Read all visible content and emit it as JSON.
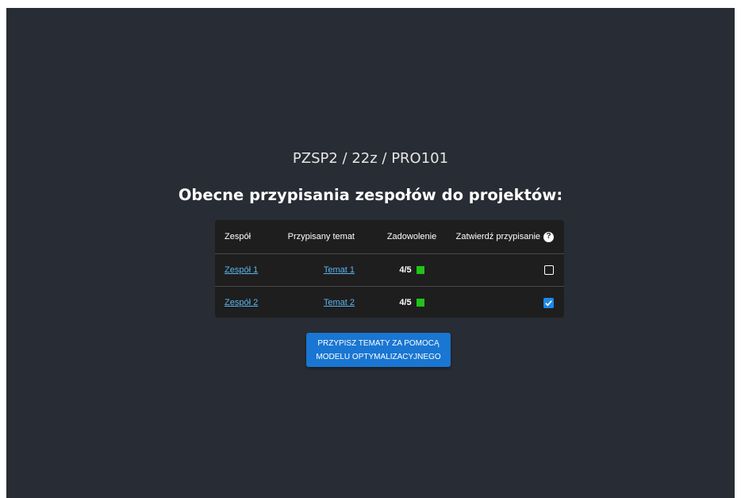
{
  "breadcrumb": "PZSP2 / 22z / PRO101",
  "page_title": "Obecne przypisania zespołów do projektów:",
  "table": {
    "headers": {
      "team": "Zespół",
      "topic": "Przypisany temat",
      "satisfaction": "Zadowolenie",
      "confirm": "Zatwierdź przypisanie",
      "help_icon": "?"
    },
    "rows": [
      {
        "team": "Zespół 1",
        "topic": "Temat 1",
        "satisfaction": "4/5",
        "satisfaction_color": "#22c318",
        "confirmed": false
      },
      {
        "team": "Zespół 2",
        "topic": "Temat 2",
        "satisfaction": "4/5",
        "satisfaction_color": "#22c318",
        "confirmed": true
      }
    ]
  },
  "assign_button": {
    "line1": "PRZYPISZ TEMATY ZA POMOCĄ",
    "line2": "MODELU OPTYMALIZACYJNEGO"
  },
  "colors": {
    "background": "#282c34",
    "table_background": "#1e1e1e",
    "link": "#5ab4f0",
    "accent": "#1976d2"
  },
  "icons": {
    "help": "help-circle-icon",
    "checkbox_checked": "checkmark-icon"
  }
}
